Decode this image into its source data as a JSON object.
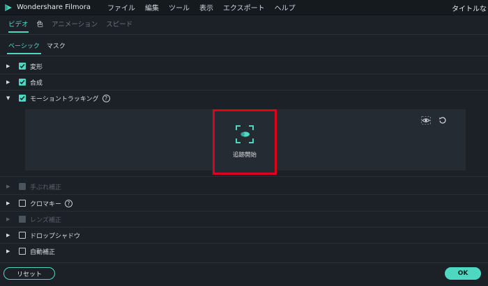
{
  "app": {
    "name": "Wondershare Filmora",
    "title_right": "タイトルな"
  },
  "menu": [
    "ファイル",
    "編集",
    "ツール",
    "表示",
    "エクスポート",
    "ヘルプ"
  ],
  "tabs": [
    {
      "label": "ビデオ",
      "state": "active"
    },
    {
      "label": "色",
      "state": "enabled"
    },
    {
      "label": "アニメーション",
      "state": "disabled"
    },
    {
      "label": "スピード",
      "state": "disabled"
    }
  ],
  "subtabs": [
    {
      "label": "ベーシック",
      "active": true
    },
    {
      "label": "マスク",
      "active": false
    }
  ],
  "sections": {
    "transform": {
      "label": "変形",
      "checked": true
    },
    "composite": {
      "label": "合成",
      "checked": true
    },
    "motion_tracking": {
      "label": "モーショントラッキング",
      "checked": true
    },
    "stabilization": {
      "label": "手ぶれ補正",
      "checked": false
    },
    "chroma_key": {
      "label": "クロマキー",
      "checked": false
    },
    "lens_correction": {
      "label": "レンズ補正",
      "checked": false
    },
    "drop_shadow": {
      "label": "ドロップシャドウ",
      "checked": false
    },
    "auto_enhance": {
      "label": "自動補正",
      "checked": false
    }
  },
  "tracking": {
    "start_label": "追跡開始"
  },
  "help_glyph": "?",
  "footer": {
    "reset_label": "リセット",
    "ok_label": "OK"
  },
  "colors": {
    "accent": "#4fd8c1",
    "highlight": "#e0001b",
    "background": "#1c2128",
    "panel": "#252b33"
  }
}
